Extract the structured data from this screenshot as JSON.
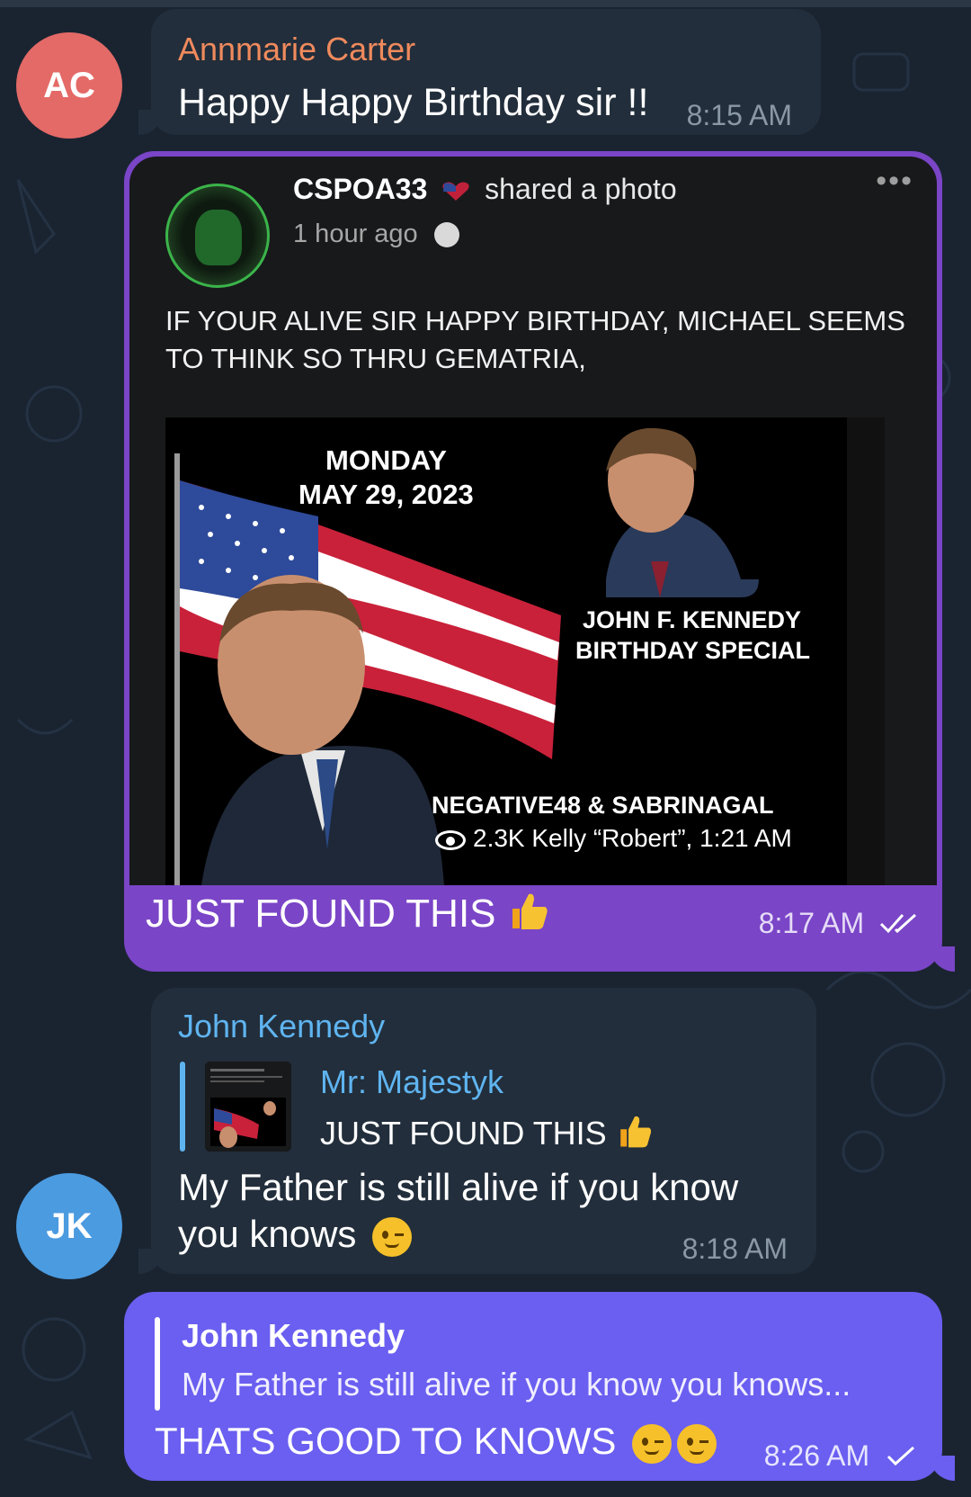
{
  "colors": {
    "background": "#1a2431",
    "incoming_bubble": "#222e3b",
    "outgoing_photo_bubble": "#7a45c7",
    "outgoing_text_bubble": "#6a5ff0",
    "sender_orange": "#f08a5d",
    "sender_blue": "#5fb4f0"
  },
  "messages": {
    "m1": {
      "avatar_initials": "AC",
      "sender": "Annmarie Carter",
      "text": "Happy Happy Birthday sir !!",
      "time": "8:15 AM"
    },
    "m2": {
      "post": {
        "page_name": "CSPOA33",
        "shared_label": "shared a photo",
        "posted_ago": "1 hour ago",
        "post_text": "IF YOUR ALIVE SIR HAPPY BIRTHDAY, MICHAEL SEEMS TO THINK SO THRU GEMATRIA,",
        "photo": {
          "date_line1": "MONDAY",
          "date_line2": "MAY 29, 2023",
          "caption_line1": "JOHN F. KENNEDY",
          "caption_line2": "BIRTHDAY SPECIAL",
          "caption_line3": "NEGATIVE48 & SABRINAGAL",
          "meta_line": "2.3K Kelly “Robert”, 1:21 AM"
        }
      },
      "caption": "JUST FOUND THIS",
      "time": "8:17 AM",
      "status_icon": "double-check"
    },
    "m3": {
      "avatar_initials": "JK",
      "sender": "John Kennedy",
      "reply_name": "Mr: Majestyk",
      "reply_text": "JUST FOUND THIS",
      "text": "My Father is still alive if you know you knows",
      "time": "8:18 AM"
    },
    "m4": {
      "reply_name": "John Kennedy",
      "reply_text": "My Father is still alive if you know you knows...",
      "text": "THATS GOOD TO KNOWS",
      "time": "8:26 AM",
      "status_icon": "single-check"
    }
  }
}
